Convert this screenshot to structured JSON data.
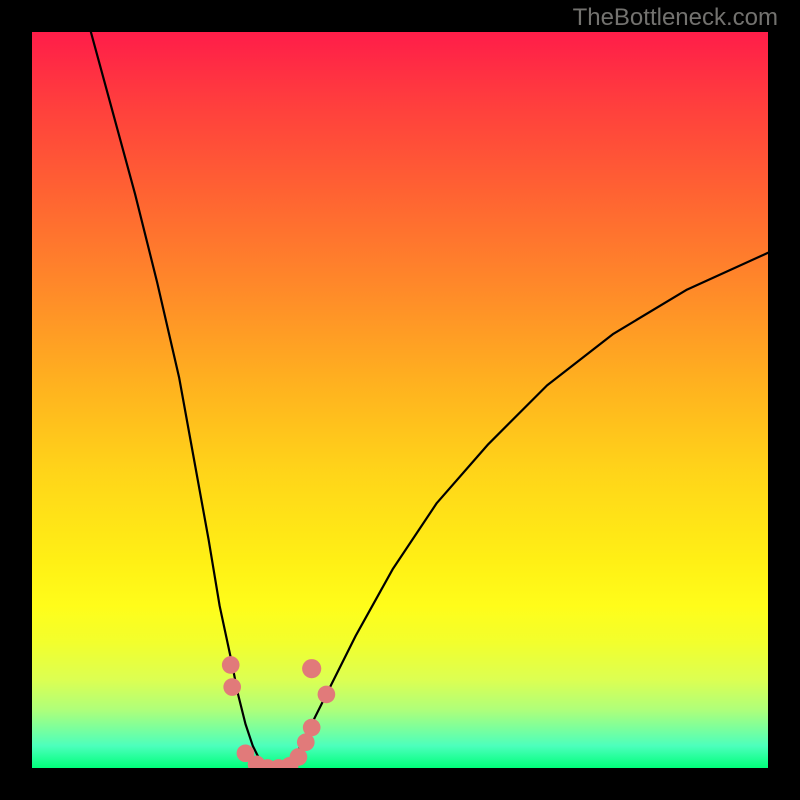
{
  "watermark": "TheBottleneck.com",
  "chart_data": {
    "type": "line",
    "title": "",
    "xlabel": "",
    "ylabel": "",
    "xlim": [
      0,
      100
    ],
    "ylim": [
      0,
      100
    ],
    "gradient_stops": [
      {
        "pct": 0,
        "color": "#ff1d49"
      },
      {
        "pct": 10,
        "color": "#ff3f3d"
      },
      {
        "pct": 22,
        "color": "#ff6332"
      },
      {
        "pct": 35,
        "color": "#ff8a29"
      },
      {
        "pct": 48,
        "color": "#ffb21f"
      },
      {
        "pct": 60,
        "color": "#ffd519"
      },
      {
        "pct": 72,
        "color": "#fff015"
      },
      {
        "pct": 78,
        "color": "#fffd1a"
      },
      {
        "pct": 83,
        "color": "#f2ff2d"
      },
      {
        "pct": 88,
        "color": "#dcff52"
      },
      {
        "pct": 92,
        "color": "#b0ff79"
      },
      {
        "pct": 97,
        "color": "#4cffbc"
      },
      {
        "pct": 100,
        "color": "#00ff7a"
      }
    ],
    "series": [
      {
        "name": "left-curve",
        "color": "#000000",
        "x": [
          8,
          11,
          14,
          17,
          20,
          22,
          24,
          25.5,
          27,
          28,
          29,
          30,
          31.5
        ],
        "y": [
          100,
          89,
          78,
          66,
          53,
          42,
          31,
          22,
          15,
          10,
          6,
          3,
          0
        ]
      },
      {
        "name": "right-curve",
        "color": "#000000",
        "x": [
          35,
          37,
          40,
          44,
          49,
          55,
          62,
          70,
          79,
          89,
          100
        ],
        "y": [
          0,
          4,
          10,
          18,
          27,
          36,
          44,
          52,
          59,
          65,
          70
        ]
      },
      {
        "name": "valley-floor",
        "color": "#000000",
        "x": [
          31.5,
          33,
          34,
          35
        ],
        "y": [
          0,
          -0.2,
          -0.2,
          0
        ]
      }
    ],
    "markers": [
      {
        "x": 27.0,
        "y": 14,
        "r": 1.2,
        "color": "#e17a7a"
      },
      {
        "x": 27.2,
        "y": 11,
        "r": 1.2,
        "color": "#e17a7a"
      },
      {
        "x": 29.0,
        "y": 2.0,
        "r": 1.2,
        "color": "#e17a7a"
      },
      {
        "x": 30.5,
        "y": 0.5,
        "r": 1.2,
        "color": "#e17a7a"
      },
      {
        "x": 32.0,
        "y": 0.0,
        "r": 1.2,
        "color": "#e17a7a"
      },
      {
        "x": 33.5,
        "y": 0.0,
        "r": 1.2,
        "color": "#e17a7a"
      },
      {
        "x": 35.0,
        "y": 0.3,
        "r": 1.2,
        "color": "#e17a7a"
      },
      {
        "x": 36.2,
        "y": 1.5,
        "r": 1.2,
        "color": "#e17a7a"
      },
      {
        "x": 37.2,
        "y": 3.5,
        "r": 1.2,
        "color": "#e17a7a"
      },
      {
        "x": 38.0,
        "y": 5.5,
        "r": 1.2,
        "color": "#e17a7a"
      },
      {
        "x": 38.0,
        "y": 13.5,
        "r": 1.3,
        "color": "#e17a7a"
      },
      {
        "x": 40.0,
        "y": 10.0,
        "r": 1.2,
        "color": "#e17a7a"
      }
    ]
  }
}
